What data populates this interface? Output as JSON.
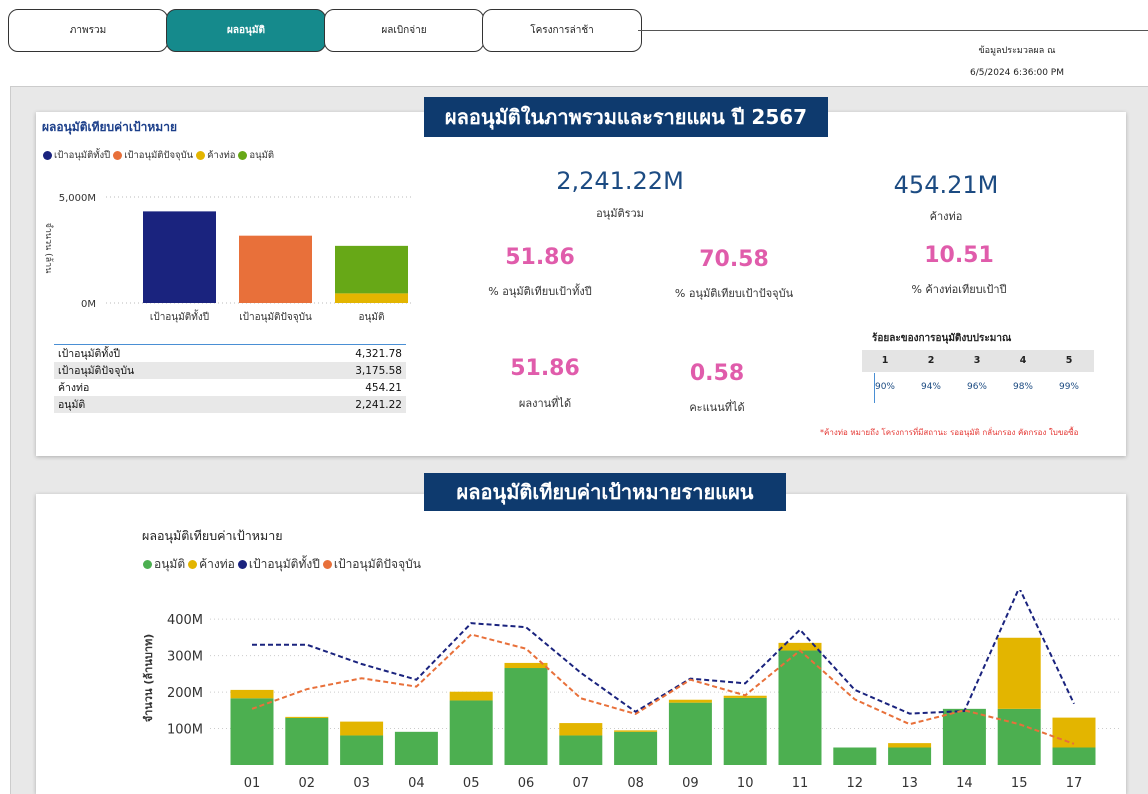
{
  "tabs": [
    {
      "label": "ภาพรวม",
      "active": false
    },
    {
      "label": "ผลอนุมัติ",
      "active": true
    },
    {
      "label": "ผลเบิกจ่าย",
      "active": false
    },
    {
      "label": "โครงการล่าช้า",
      "active": false
    }
  ],
  "processed": {
    "label": "ข้อมูลประมวลผล ณ",
    "datetime": "6/5/2024 6:36:00 PM"
  },
  "top_banner": "ผลอนุมัติในภาพรวมและรายแผน ปี 2567",
  "bottom_banner": "ผลอนุมัติเทียบค่าเป้าหมายรายแผน",
  "left_card": {
    "title": "ผลอนุมัติเทียบค่าเป้าหมาย",
    "legend": [
      "เป้าอนุมัติทั้งปี",
      "เป้าอนุมัติปัจจุบัน",
      "ค้างท่อ",
      "อนุมัติ"
    ],
    "table": [
      {
        "label": "เป้าอนุมัติทั้งปี",
        "value": "4,321.78"
      },
      {
        "label": "เป้าอนุมัติปัจจุบัน",
        "value": "3,175.58"
      },
      {
        "label": "ค้างท่อ",
        "value": "454.21"
      },
      {
        "label": "อนุมัติ",
        "value": "2,241.22"
      }
    ]
  },
  "kpis": {
    "approved_total": {
      "value": "2,241.22M",
      "label": "อนุมัติรวม"
    },
    "pending_total": {
      "value": "454.21M",
      "label": "ค้างท่อ"
    },
    "pct_year": {
      "value": "51.86",
      "label": "% อนุมัติเทียบเป้าทั้งปี"
    },
    "pct_current": {
      "value": "70.58",
      "label": "% อนุมัติเทียบเป้าปัจจุบัน"
    },
    "pct_pending": {
      "value": "10.51",
      "label": "% ค้างท่อเทียบเป้าปี"
    },
    "performance": {
      "value": "51.86",
      "label": "ผลงานที่ได้"
    },
    "score": {
      "value": "0.58",
      "label": "คะแนนที่ได้"
    }
  },
  "score_table": {
    "title": "ร้อยละของการอนุมัติงบประมาณ",
    "headers": [
      "1",
      "2",
      "3",
      "4",
      "5"
    ],
    "values": [
      "90%",
      "94%",
      "96%",
      "98%",
      "99%"
    ]
  },
  "note": "*ค้างท่อ หมายถึง โครงการที่มีสถานะ รออนุมัติ กลั่นกรอง คัดกรอง ใบขอซื้อ",
  "colors": {
    "navy": "#1a237e",
    "orange": "#e8703a",
    "yellow": "#e3b500",
    "green": "#4caf50",
    "green_dark": "#67a817",
    "pink": "#e05cab",
    "banner": "#0e3a6e",
    "teal": "#158a8c"
  },
  "chart_data": [
    {
      "type": "bar",
      "title": "",
      "ylabel": "จำนวน (ล้าน",
      "categories": [
        "เป้าอนุมัติทั้งปี",
        "เป้าอนุมัติปัจจุบัน",
        "อนุมัติ"
      ],
      "series": [
        {
          "name": "อนุมัติ",
          "values": [
            0,
            0,
            2241.22
          ]
        },
        {
          "name": "ค้างท่อ",
          "values": [
            0,
            0,
            454.21
          ]
        },
        {
          "name": "เป้าอนุมัติทั้งปี",
          "values": [
            4321.78,
            0,
            0
          ]
        },
        {
          "name": "เป้าอนุมัติปัจจุบัน",
          "values": [
            0,
            3175.58,
            0
          ]
        }
      ],
      "yticks": [
        "0M",
        "5,000M"
      ],
      "ylim": [
        0,
        5000
      ]
    },
    {
      "type": "bar",
      "title": "ผลอนุมัติเทียบค่าเป้าหมาย",
      "ylabel": "จำนวน (ล้านบาท)",
      "legend": [
        "อนุมัติ",
        "ค้างท่อ",
        "เป้าอนุมัติทั้งปี",
        "เป้าอนุมัติปัจจุบัน"
      ],
      "categories": [
        "01",
        "02",
        "03",
        "04",
        "05",
        "06",
        "07",
        "08",
        "09",
        "10",
        "11",
        "12",
        "13",
        "14",
        "15",
        "17"
      ],
      "series": [
        {
          "name": "อนุมัติ",
          "kind": "bar",
          "values": [
            183,
            129,
            81,
            91,
            177,
            266,
            81,
            91,
            171,
            184,
            314,
            48,
            48,
            154,
            154,
            48
          ]
        },
        {
          "name": "ค้างท่อ",
          "kind": "bar",
          "values": [
            23,
            3,
            38,
            0,
            24,
            14,
            34,
            4,
            8,
            6,
            21,
            0,
            12,
            0,
            195,
            82
          ]
        },
        {
          "name": "เป้าอนุมัติทั้งปี",
          "kind": "line",
          "values": [
            330,
            330,
            277,
            234,
            389,
            378,
            253,
            146,
            237,
            224,
            371,
            206,
            141,
            148,
            486,
            168
          ]
        },
        {
          "name": "เป้าอนุมัติปัจจุบัน",
          "kind": "line",
          "values": [
            154,
            208,
            238,
            215,
            358,
            319,
            183,
            140,
            234,
            191,
            314,
            180,
            112,
            150,
            112,
            58
          ]
        }
      ],
      "yticks": [
        "100M",
        "200M",
        "300M",
        "400M"
      ],
      "ylim": [
        0,
        480
      ]
    }
  ]
}
